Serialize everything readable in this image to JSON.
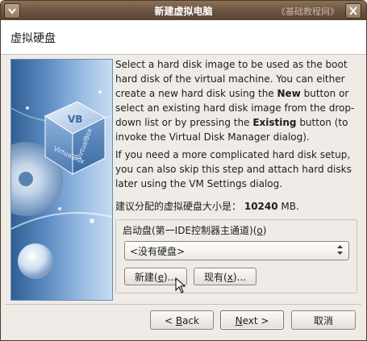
{
  "window": {
    "title": "新建虚拟电脑",
    "watermark": "《基础教程网》",
    "menu_icon": "window-menu-icon",
    "close_icon": "close-icon"
  },
  "header": {
    "title": "虚拟硬盘"
  },
  "content": {
    "para1_a": "Select a hard disk image to be used as the boot hard disk of the virtual machine. You can either create a new hard disk using the ",
    "para1_new": "New",
    "para1_b": " button or select an existing hard disk image from the drop-down list or by pressing the ",
    "para1_existing": "Existing",
    "para1_c": " button (to invoke the Virtual Disk Manager dialog).",
    "para2": "If you need a more complicated hard disk setup, you can also skip this step and attach hard disks later using the VM Settings dialog.",
    "size_prefix": "建议分配的虚拟硬盘大小是：",
    "size_value": "10240",
    "size_unit": " MB."
  },
  "boot_group": {
    "label_prefix": "启动盘(第一IDE控制器主通道)(",
    "label_key": "o",
    "label_suffix": ")",
    "combo_value": "<没有硬盘>",
    "new_btn_prefix": "新建(",
    "new_btn_key": "e",
    "new_btn_suffix": ")...",
    "existing_btn_prefix": "现有(",
    "existing_btn_key": "x",
    "existing_btn_suffix": ")..."
  },
  "footer": {
    "back_prefix": "< ",
    "back_key": "B",
    "back_rest": "ack",
    "next_key": "N",
    "next_rest": "ext >",
    "cancel": "取消"
  },
  "colors": {
    "titlebar": "#6a5340",
    "sidebar_blue": "#5b8bc0",
    "window_bg": "#efebe7"
  }
}
